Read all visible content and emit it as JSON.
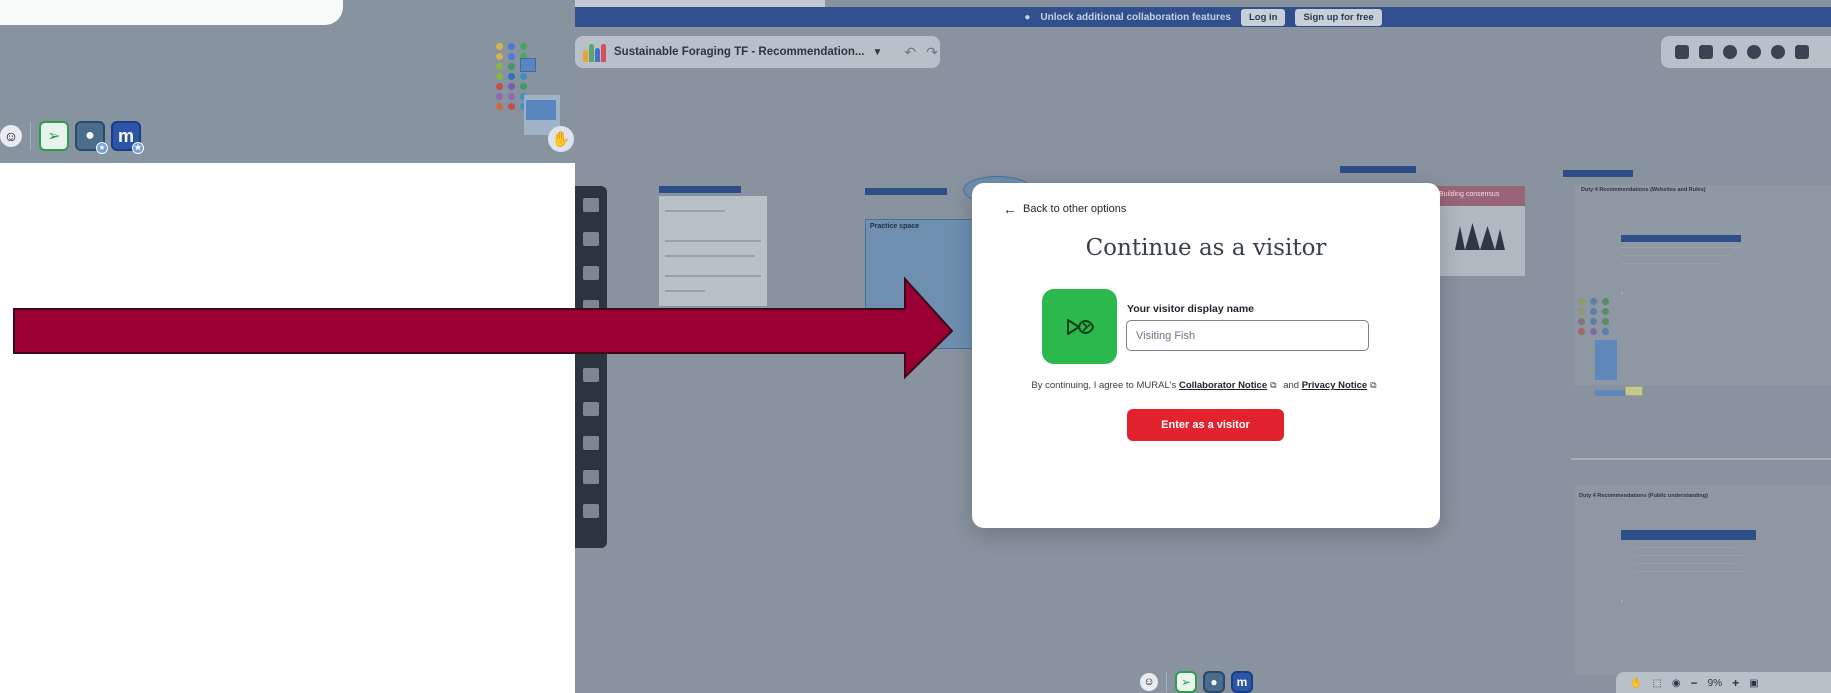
{
  "colors": {
    "board_dim": "#88939f",
    "banner": "#304f8c",
    "arrow_fill": "#9a0033",
    "primary_button": "#e2232e",
    "avatar_green": "#2bb84c"
  },
  "banner": {
    "message": "Unlock additional collaboration features",
    "login_label": "Log in",
    "signup_label": "Sign up for free"
  },
  "board": {
    "title": "Sustainable Foraging TF - Recommendation...",
    "zoom_level": "9%",
    "frame_text": {
      "practice_space": "Practice space",
      "building_consensus": "Building consensus",
      "duty4_title": "Duty 4 Recommendations (Websites and Rules)",
      "duty4_public": "Duty 4 Recommendations (Public understanding)"
    }
  },
  "modal": {
    "back_label": "Back to other options",
    "title": "Continue as a visitor",
    "name_label": "Your visitor display name",
    "name_placeholder": "Visiting Fish",
    "consent_prefix": "By continuing, I agree to MURAL's",
    "collaborator_notice": "Collaborator Notice",
    "consent_and": "and",
    "privacy_notice": "Privacy Notice",
    "enter_button": "Enter as a visitor"
  }
}
